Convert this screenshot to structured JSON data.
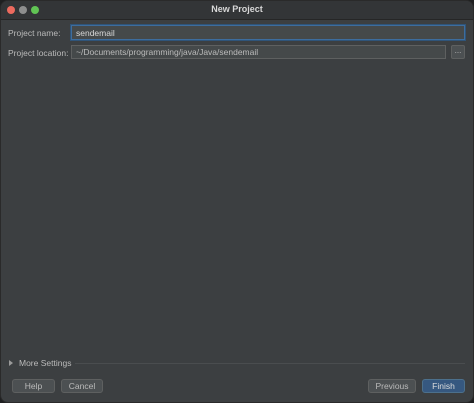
{
  "window": {
    "title": "New Project"
  },
  "form": {
    "project_name_label": "Project name:",
    "project_name_value": "sendemail",
    "project_location_label": "Project location:",
    "project_location_value": "~/Documents/programming/java/Java/sendemail",
    "browse_label": "..."
  },
  "more_settings": {
    "label": "More Settings"
  },
  "buttons": {
    "help": "Help",
    "cancel": "Cancel",
    "previous": "Previous",
    "finish": "Finish"
  },
  "colors": {
    "background": "#3c3f41",
    "accent": "#365880",
    "focus_border": "#3d6d9e",
    "text": "#bbbbbb"
  }
}
